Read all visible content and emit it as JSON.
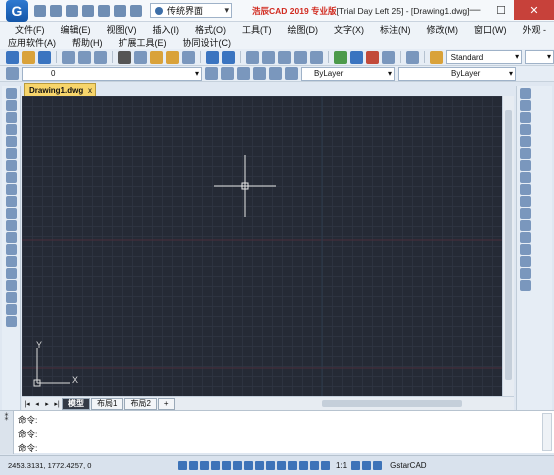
{
  "app": {
    "logo": "G",
    "workspace": "传统界面",
    "title_app": "浩辰CAD 2019 专业版",
    "title_rest": "[Trial Day Left 25] - [Drawing1.dwg]",
    "min": "—",
    "max": "☐",
    "close": "✕"
  },
  "menu": {
    "row1": [
      "文件(F)",
      "编辑(E)",
      "视图(V)",
      "插入(I)",
      "格式(O)",
      "工具(T)",
      "绘图(D)",
      "文字(X)",
      "标注(N)",
      "修改(M)",
      "窗口(W)"
    ],
    "row1_right": "外观 -",
    "row2": [
      "应用软件(A)",
      "帮助(H)",
      "扩展工具(E)",
      "协同设计(C)"
    ]
  },
  "toolbar": {
    "text_style": "Standard",
    "layer_value": "0",
    "color": "ByLayer",
    "linetype": "ByLayer"
  },
  "document": {
    "tab": "Drawing1.dwg",
    "tab_close": "x"
  },
  "ucs": {
    "x": "X",
    "y": "Y"
  },
  "layout_tabs": [
    "模型",
    "布局1",
    "布局2",
    "+"
  ],
  "command": {
    "lines": [
      "命令:",
      "命令:",
      "命令:"
    ],
    "grip": "⁑"
  },
  "status": {
    "coords": "2453.3131, 1772.4257, 0",
    "scale": "1:1",
    "brand": "GstarCAD"
  },
  "colors": {
    "canvas": "#252a35",
    "grid": "#2d3340",
    "crosshair": "#e8e8e8",
    "accent": "#f7d56b"
  }
}
